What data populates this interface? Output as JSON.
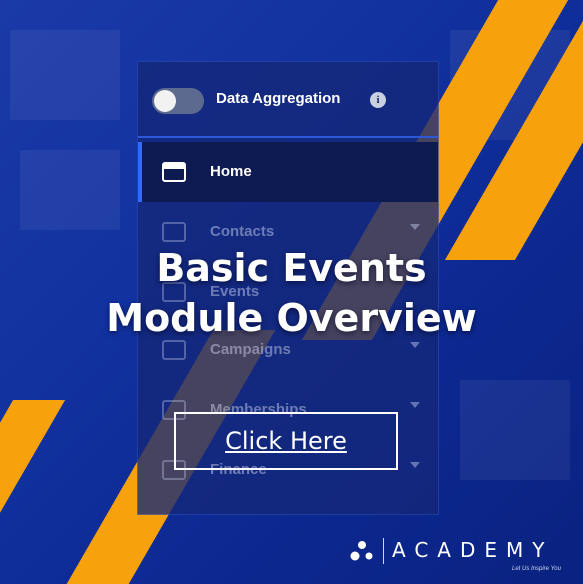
{
  "menu": {
    "toggle_label": "Data Aggregation",
    "info_glyph": "i",
    "items": [
      {
        "label": "Home",
        "icon": "home-icon",
        "active": true
      },
      {
        "label": "Contacts",
        "icon": "contacts-icon",
        "active": false
      },
      {
        "label": "Events",
        "icon": "events-icon",
        "active": false
      },
      {
        "label": "Campaigns",
        "icon": "campaigns-icon",
        "active": false
      },
      {
        "label": "Memberships",
        "icon": "memberships-icon",
        "active": false
      },
      {
        "label": "Finance",
        "icon": "finance-icon",
        "active": false
      }
    ]
  },
  "headline": {
    "line1": "Basic Events",
    "line2": "Module Overview"
  },
  "cta": {
    "label": "Click Here"
  },
  "brand": {
    "name": "ACADEMY",
    "tagline": "Let Us Inspire You"
  },
  "colors": {
    "background": "#1232a0",
    "accent_stripe": "#f7a20c",
    "active_indicator": "#2f6bff"
  }
}
